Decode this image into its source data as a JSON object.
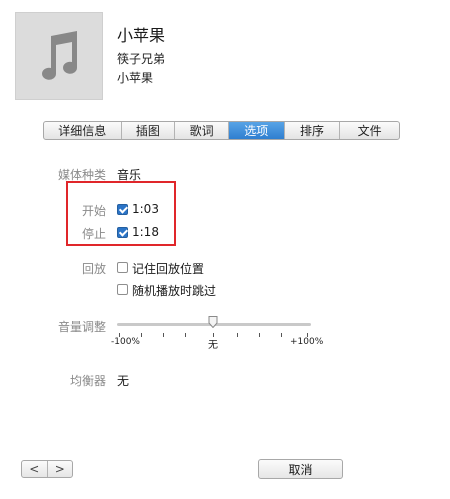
{
  "track": {
    "title": "小苹果",
    "artist": "筷子兄弟",
    "album": "小苹果"
  },
  "artwork": {
    "icon": "music-note-icon"
  },
  "tabs": [
    {
      "label": "详细信息",
      "active": false
    },
    {
      "label": "插图",
      "active": false
    },
    {
      "label": "歌词",
      "active": false
    },
    {
      "label": "选项",
      "active": true
    },
    {
      "label": "排序",
      "active": false
    },
    {
      "label": "文件",
      "active": false
    }
  ],
  "options": {
    "media_kind": {
      "label": "媒体种类",
      "value": "音乐"
    },
    "start": {
      "label": "开始",
      "value": "1:03",
      "checked": true
    },
    "stop": {
      "label": "停止",
      "value": "1:18",
      "checked": true
    },
    "playback": {
      "label": "回放",
      "remember_position": {
        "label": "记住回放位置",
        "checked": false
      },
      "skip_shuffle": {
        "label": "随机播放时跳过",
        "checked": false
      }
    },
    "volume": {
      "label": "音量调整",
      "min_label": "-100%",
      "mid_label": "无",
      "max_label": "+100%",
      "value": 0
    },
    "equalizer": {
      "label": "均衡器",
      "value": "无"
    }
  },
  "footer": {
    "prev_label": "<",
    "next_label": ">",
    "cancel_label": "取消"
  },
  "colors": {
    "accent": "#2f7fd0",
    "highlight": "#e0262a"
  }
}
